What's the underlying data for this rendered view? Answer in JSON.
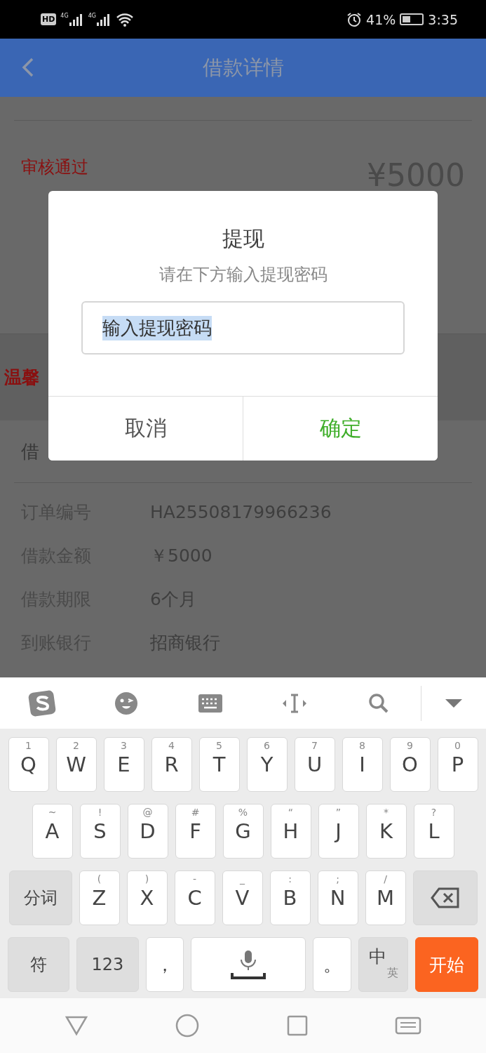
{
  "status_bar": {
    "badge": "HD",
    "networks": [
      "4G",
      "4G"
    ],
    "battery": "41%",
    "time": "3:35"
  },
  "header": {
    "title": "借款详情"
  },
  "review": {
    "status": "审核通过",
    "amount": "¥5000"
  },
  "notice": {
    "label": "温馨"
  },
  "section": {
    "title": "借"
  },
  "details": [
    {
      "label": "订单编号",
      "value": "HA25508179966236"
    },
    {
      "label": "借款金额",
      "value": "￥5000"
    },
    {
      "label": "借款期限",
      "value": "6个月"
    },
    {
      "label": "到账银行",
      "value": "招商银行"
    }
  ],
  "dialog": {
    "title": "提现",
    "subtitle": "请在下方输入提现密码",
    "field": {
      "value": "输入提现密码",
      "text_selected": true
    },
    "buttons": [
      {
        "label": "取消",
        "kind": "cancel"
      },
      {
        "label": "确定",
        "kind": "confirm"
      }
    ]
  },
  "keyboard": {
    "rows": [
      {
        "keys": [
          {
            "kind": "letter",
            "label": "Q",
            "hint": "1"
          },
          {
            "kind": "letter",
            "label": "W",
            "hint": "2"
          },
          {
            "kind": "letter",
            "label": "E",
            "hint": "3"
          },
          {
            "kind": "letter",
            "label": "R",
            "hint": "4"
          },
          {
            "kind": "letter",
            "label": "T",
            "hint": "5"
          },
          {
            "kind": "letter",
            "label": "Y",
            "hint": "6"
          },
          {
            "kind": "letter",
            "label": "U",
            "hint": "7"
          },
          {
            "kind": "letter",
            "label": "I",
            "hint": "8"
          },
          {
            "kind": "letter",
            "label": "O",
            "hint": "9"
          },
          {
            "kind": "letter",
            "label": "P",
            "hint": "0"
          }
        ]
      },
      {
        "keys": [
          {
            "kind": "letter",
            "label": "A",
            "hint": "~"
          },
          {
            "kind": "letter",
            "label": "S",
            "hint": "!"
          },
          {
            "kind": "letter",
            "label": "D",
            "hint": "@"
          },
          {
            "kind": "letter",
            "label": "F",
            "hint": "#"
          },
          {
            "kind": "letter",
            "label": "G",
            "hint": "%"
          },
          {
            "kind": "letter",
            "label": "H",
            "hint": "“"
          },
          {
            "kind": "letter",
            "label": "J",
            "hint": "”"
          },
          {
            "kind": "letter",
            "label": "K",
            "hint": "*"
          },
          {
            "kind": "letter",
            "label": "L",
            "hint": "?"
          }
        ]
      },
      {
        "keys": [
          {
            "kind": "func",
            "label": "分词"
          },
          {
            "kind": "letter",
            "label": "Z",
            "hint": "("
          },
          {
            "kind": "letter",
            "label": "X",
            "hint": ")"
          },
          {
            "kind": "letter",
            "label": "C",
            "hint": "-"
          },
          {
            "kind": "letter",
            "label": "V",
            "hint": "_"
          },
          {
            "kind": "letter",
            "label": "B",
            "hint": ":"
          },
          {
            "kind": "letter",
            "label": "N",
            "hint": ";"
          },
          {
            "kind": "letter",
            "label": "M",
            "hint": "/"
          },
          {
            "kind": "backspace"
          }
        ]
      },
      {
        "keys": [
          {
            "kind": "func",
            "label": "符"
          },
          {
            "kind": "func",
            "label": "123"
          },
          {
            "kind": "punct",
            "label": "，"
          },
          {
            "kind": "space"
          },
          {
            "kind": "punct",
            "label": "。"
          },
          {
            "kind": "lang",
            "label": "中",
            "hint": "英"
          },
          {
            "kind": "enter",
            "label": "开始"
          }
        ]
      }
    ]
  }
}
